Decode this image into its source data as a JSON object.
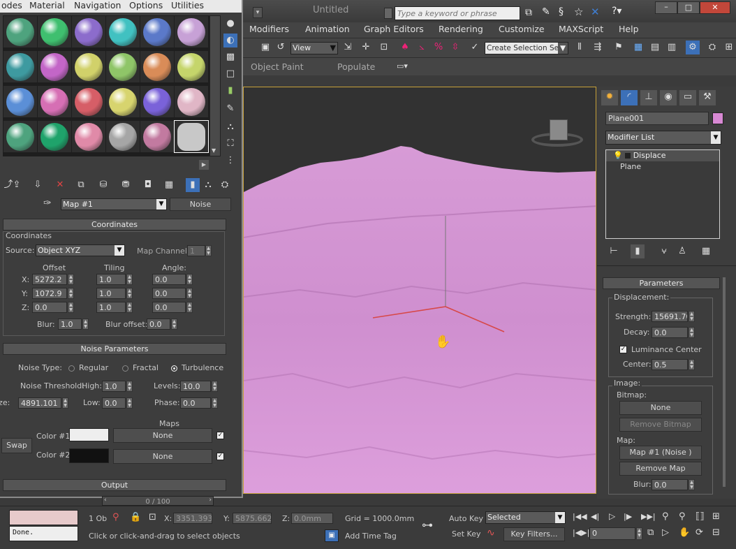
{
  "app": {
    "title": "Untitled",
    "search_placeholder": "Type a keyword or phrase",
    "menu": [
      "Modifiers",
      "Animation",
      "Graph Editors",
      "Rendering",
      "Customize",
      "MAXScript",
      "Help"
    ],
    "view_dropdown": "View",
    "selection_set": "Create Selection Se",
    "ribbon_tabs": [
      "Object Paint",
      "Populate"
    ]
  },
  "material_editor": {
    "menu": [
      "odes",
      "Material",
      "Navigation",
      "Options",
      "Utilities"
    ],
    "spheres": [
      "#4ea37e",
      "#3fbf6f",
      "#8c6ccc",
      "#41c1c1",
      "#5b79c9",
      "#c7a1d6",
      "#3e9aa0",
      "#c366c7",
      "#d1d16a",
      "#8fc568",
      "#d98c58",
      "#c5d56b",
      "#5b8fd7",
      "#d66fb4",
      "#d65e67",
      "#d7d46e",
      "#7a62d9",
      "#e0b6c6",
      "#4ea37e",
      "#1fa36b",
      "#e08aa8",
      "#a6a6a6",
      "#c27aa0",
      "#c8c8c8"
    ],
    "map_name": "Map #1",
    "map_type": "Noise",
    "coordinates": {
      "rollout": "Coordinates",
      "group": "Coordinates",
      "source_label": "Source:",
      "source_value": "Object XYZ",
      "map_channel_label": "Map Channel:",
      "map_channel_value": "1",
      "offset_label": "Offset",
      "tiling_label": "Tiling",
      "angle_label": "Angle:",
      "rows": [
        {
          "axis": "X:",
          "offset": "5272.2",
          "tiling": "1.0",
          "angle": "0.0"
        },
        {
          "axis": "Y:",
          "offset": "1072.9",
          "tiling": "1.0",
          "angle": "0.0"
        },
        {
          "axis": "Z:",
          "offset": "0.0",
          "tiling": "1.0",
          "angle": "0.0"
        }
      ],
      "blur_label": "Blur:",
      "blur_value": "1.0",
      "blur_offset_label": "Blur offset:",
      "blur_offset_value": "0.0"
    },
    "noise": {
      "rollout": "Noise Parameters",
      "type_label": "Noise Type:",
      "types": [
        "Regular",
        "Fractal",
        "Turbulence"
      ],
      "selected_type": "Turbulence",
      "threshold_label": "Noise Threshold:",
      "high_label": "High:",
      "high_value": "1.0",
      "levels_label": "Levels:",
      "levels_value": "10.0",
      "size_label": "Size:",
      "size_value": "4891.101",
      "low_label": "Low:",
      "low_value": "0.0",
      "phase_label": "Phase:",
      "phase_value": "0.0",
      "maps_label": "Maps",
      "swap_label": "Swap",
      "color1_label": "Color #1",
      "color1": "#eeeeee",
      "color2_label": "Color #2",
      "color2": "#111111",
      "map_none": "None"
    },
    "output_rollout": "Output"
  },
  "command_panel": {
    "object_name": "Plane001",
    "object_color": "#d889d4",
    "modifier_list": "Modifier List",
    "stack": [
      "Displace",
      "Plane"
    ],
    "parameters_rollout": "Parameters",
    "displacement_group": "Displacement:",
    "strength_label": "Strength:",
    "strength_value": "15691.70",
    "decay_label": "Decay:",
    "decay_value": "0.0",
    "luminance_label": "Luminance Center",
    "center_label": "Center:",
    "center_value": "0.5",
    "image_group": "Image:",
    "bitmap_label": "Bitmap:",
    "bitmap_button": "None",
    "remove_bitmap": "Remove Bitmap",
    "map_label": "Map:",
    "map_button": "Map #1  (Noise )",
    "remove_map": "Remove Map",
    "blur_label": "Blur:",
    "blur_value": "0.0"
  },
  "status": {
    "timeline": "0 / 100",
    "selected_count": "1 Ob",
    "x_label": "X:",
    "x_value": "3351.393m",
    "y_label": "Y:",
    "y_value": "5875.662m",
    "z_label": "Z:",
    "z_value": "0.0mm",
    "grid": "Grid = 1000.0mm",
    "auto_key": "Auto Key",
    "key_mode": "Selected",
    "set_key": "Set Key",
    "key_filters": "Key Filters...",
    "frame_value": "0",
    "add_time_tag": "Add Time Tag",
    "prompt": "Click or click-and-drag to select objects",
    "script_listener": "Done."
  }
}
